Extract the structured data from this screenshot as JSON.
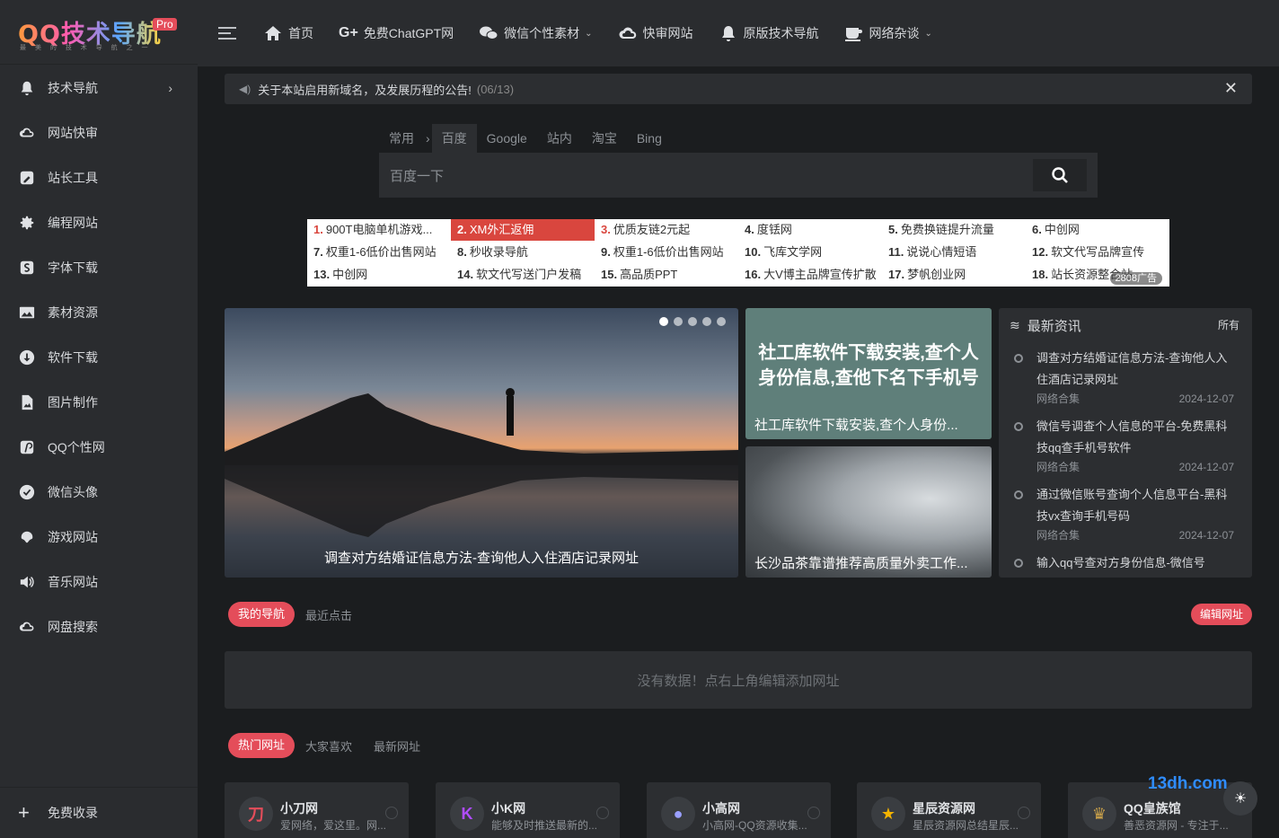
{
  "logo": {
    "main": "QQ技术导航",
    "pro": "Pro",
    "sub": "最 美 的 技 术 导 航 之 一"
  },
  "sidebar": {
    "items": [
      {
        "label": "技术导航",
        "icon": "bell-icon"
      },
      {
        "label": "网站快审",
        "icon": "cloud-icon"
      },
      {
        "label": "站长工具",
        "icon": "tools-icon"
      },
      {
        "label": "编程网站",
        "icon": "gear-icon"
      },
      {
        "label": "字体下载",
        "icon": "font-icon"
      },
      {
        "label": "素材资源",
        "icon": "image-icon"
      },
      {
        "label": "软件下载",
        "icon": "download-icon"
      },
      {
        "label": "图片制作",
        "icon": "file-image-icon"
      },
      {
        "label": "QQ个性网",
        "icon": "pinterest-icon"
      },
      {
        "label": "微信头像",
        "icon": "check-circle-icon"
      },
      {
        "label": "游戏网站",
        "icon": "gamepad-icon"
      },
      {
        "label": "音乐网站",
        "icon": "volume-icon"
      },
      {
        "label": "网盘搜索",
        "icon": "cloud-icon"
      }
    ],
    "bottom": "免费收录"
  },
  "topnav": [
    {
      "label": "首页",
      "icon": "home-icon",
      "dropdown": false
    },
    {
      "label": "免费ChatGPT网",
      "icon": "google-plus-icon",
      "dropdown": false
    },
    {
      "label": "微信个性素材",
      "icon": "wechat-icon",
      "dropdown": true
    },
    {
      "label": "快审网站",
      "icon": "cloud-icon",
      "dropdown": false
    },
    {
      "label": "原版技术导航",
      "icon": "bell-icon",
      "dropdown": false
    },
    {
      "label": "网络杂谈",
      "icon": "coffee-icon",
      "dropdown": true
    }
  ],
  "notice": {
    "text": "关于本站启用新域名，及发展历程的公告!",
    "date": "(06/13)"
  },
  "search": {
    "tabs": [
      "常用",
      "百度",
      "Google",
      "站内",
      "淘宝",
      "Bing"
    ],
    "active_tab": "百度",
    "placeholder": "百度一下"
  },
  "ads": [
    {
      "num": "1.",
      "text": "900T电脑单机游戏..."
    },
    {
      "num": "2.",
      "text": "XM外汇返佣"
    },
    {
      "num": "3.",
      "text": "优质友链2元起"
    },
    {
      "num": "4.",
      "text": "度铥网"
    },
    {
      "num": "5.",
      "text": "免费换链提升流量"
    },
    {
      "num": "6.",
      "text": "中创网"
    },
    {
      "num": "7.",
      "text": "权重1-6低价出售网站"
    },
    {
      "num": "8.",
      "text": "秒收录导航"
    },
    {
      "num": "9.",
      "text": "权重1-6低价出售网站"
    },
    {
      "num": "10.",
      "text": "飞库文学网"
    },
    {
      "num": "11.",
      "text": "说说心情短语"
    },
    {
      "num": "12.",
      "text": "软文代写品牌宣传"
    },
    {
      "num": "13.",
      "text": "中创网"
    },
    {
      "num": "14.",
      "text": "软文代写送门户发稿"
    },
    {
      "num": "15.",
      "text": "高品质PPT"
    },
    {
      "num": "16.",
      "text": "大V博主品牌宣传扩散"
    },
    {
      "num": "17.",
      "text": "梦帆创业网"
    },
    {
      "num": "18.",
      "text": "站长资源整合站"
    }
  ],
  "ad_badge": "2808广告",
  "slider": {
    "title": "调查对方结婚证信息方法-查询他人入住酒店记录网址",
    "dots": 5,
    "active_dot": 0
  },
  "cards": [
    {
      "big": "社工库软件下载安装,查个人身份信息,查他下名下手机号",
      "caption": "社工库软件下载安装,查个人身份..."
    },
    {
      "caption": "长沙品茶靠谱推荐高质量外卖工作..."
    }
  ],
  "news": {
    "title": "最新资讯",
    "more": "所有",
    "items": [
      {
        "title": "调查对方结婚证信息方法-查询他人入住酒店记录网址",
        "cat": "网络合集",
        "date": "2024-12-07"
      },
      {
        "title": "微信号调查个人信息的平台-免费黑科技qq查手机号软件",
        "cat": "网络合集",
        "date": "2024-12-07"
      },
      {
        "title": "通过微信账号查询个人信息平台-黑科技vx查询手机号码",
        "cat": "网络合集",
        "date": "2024-12-07"
      },
      {
        "title": "输入qq号查对方身份信息-微信号",
        "cat": "",
        "date": ""
      }
    ]
  },
  "mynav": {
    "tab_active": "我的导航",
    "tab2": "最近点击",
    "edit": "编辑网址",
    "empty": "没有数据！点右上角编辑添加网址"
  },
  "hot": {
    "tab_active": "热门网址",
    "tab2": "大家喜欢",
    "tab3": "最新网址"
  },
  "sites": [
    {
      "name": "小刀网",
      "desc": "爱网络，爱这里。网...",
      "glyph": "刀",
      "color": "#e44d5a"
    },
    {
      "name": "小K网",
      "desc": "能够及时推送最新的...",
      "glyph": "K",
      "color": "#b04cff"
    },
    {
      "name": "小高网",
      "desc": "小高网-QQ资源收集...",
      "glyph": "●",
      "color": "#9aa0ff"
    },
    {
      "name": "星辰资源网",
      "desc": "星辰资源网总结星辰...",
      "glyph": "★",
      "color": "#f5b400"
    },
    {
      "name": "QQ皇族馆",
      "desc": "善恶资源网 - 专注于...",
      "glyph": "♛",
      "color": "#caa14a"
    }
  ],
  "watermark": "13dh.com"
}
